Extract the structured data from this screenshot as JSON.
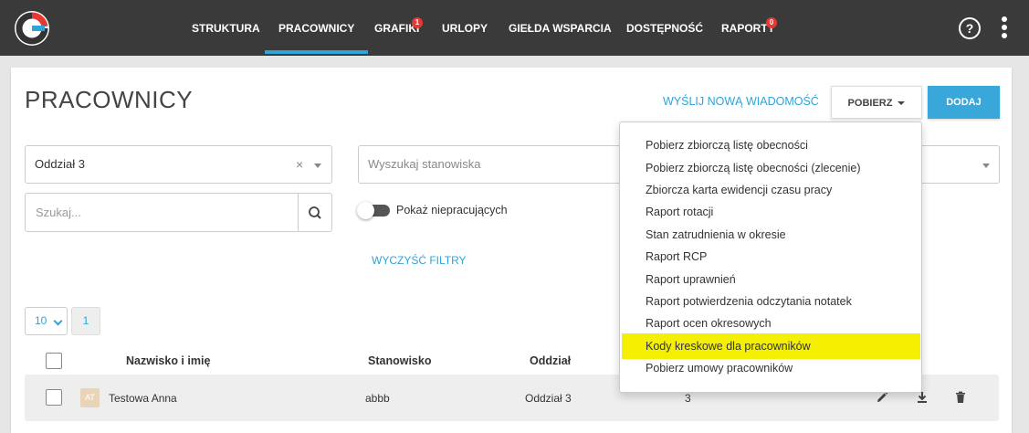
{
  "nav": {
    "items": [
      {
        "label": "STRUKTURA"
      },
      {
        "label": "PRACOWNICY",
        "active": true
      },
      {
        "label": "GRAFIKI",
        "badge": "1"
      },
      {
        "label": "URLOPY"
      },
      {
        "label": "GIEŁDA WSPARCIA"
      },
      {
        "label": "DOSTĘPNOŚĆ"
      },
      {
        "label": "RAPORTY",
        "badge": "0"
      }
    ],
    "help_icon": "?",
    "accent": "#2fa4d8",
    "badge_color": "#e53935"
  },
  "header": {
    "title": "PRACOWNICY",
    "send_message": "WYŚLIJ NOWĄ WIADOMOŚĆ",
    "download": "POBIERZ",
    "add": "DODAJ"
  },
  "filters": {
    "department_value": "Oddział 3",
    "department_clear": "×",
    "position_placeholder": "Wyszukaj stanowiska",
    "search_placeholder": "Szukaj...",
    "show_inactive_label": "Pokaż niepracujących",
    "clear_filters": "WYCZYŚĆ FILTRY"
  },
  "pagination": {
    "page_size": "10",
    "current_page": "1"
  },
  "table": {
    "columns": [
      "Nazwisko i imię",
      "Stanowisko",
      "Oddział"
    ],
    "rows": [
      {
        "initials": "AT",
        "name": "Testowa Anna",
        "position": "abbb",
        "department": "Oddział 3",
        "extra": "3"
      }
    ]
  },
  "dropdown": {
    "items": [
      "Pobierz zbiorczą listę obecności",
      "Pobierz zbiorczą listę obecności (zlecenie)",
      "Zbiorcza karta ewidencji czasu pracy",
      "Raport rotacji",
      "Stan zatrudnienia w okresie",
      "Raport RCP",
      "Raport uprawnień",
      "Raport potwierdzenia odczytania notatek",
      "Raport ocen okresowych",
      "Kody kreskowe dla pracowników",
      "Pobierz umowy pracowników"
    ],
    "highlighted_index": 9,
    "highlight_color": "#f5f002"
  }
}
